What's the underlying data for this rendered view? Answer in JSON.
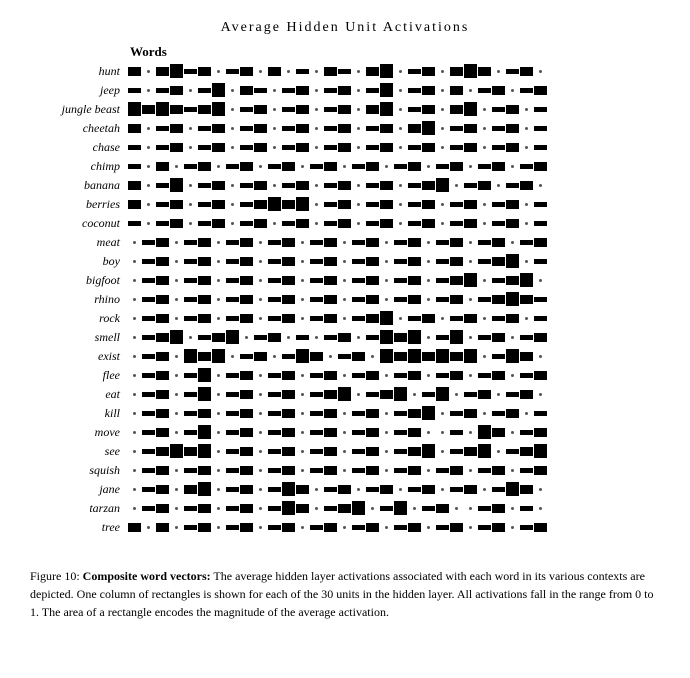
{
  "title": "Average Hidden Unit Activations",
  "words_label": "Words",
  "caption": {
    "figure_label": "Figure 10:",
    "bold_part": "Composite word vectors:",
    "text": " The average hidden layer activations associated with each word in its various contexts are depicted. One column of rectangles is shown for each of the 30 units in the hidden layer. All activations fall in the range from 0 to 1. The area of a rectangle encodes the magnitude of the average activation."
  },
  "words": [
    "hunt",
    "jeep",
    "jungle beast",
    "cheetah",
    "chase",
    "chimp",
    "banana",
    "berries",
    "coconut",
    "meat",
    "boy",
    "bigfoot",
    "rhino",
    "rock",
    "smell",
    "exist",
    "flee",
    "eat",
    "kill",
    "move",
    "see",
    "squish",
    "jane",
    "tarzan",
    "tree"
  ],
  "rows": [
    [
      2,
      0,
      1,
      2,
      3,
      0,
      1,
      2,
      0,
      1,
      2,
      0,
      1,
      3,
      0,
      1,
      2,
      0,
      1,
      2,
      3,
      0,
      1,
      2,
      0,
      1,
      2,
      3,
      0,
      1
    ],
    [
      1,
      0,
      1,
      2,
      0,
      1,
      2,
      3,
      0,
      1,
      2,
      0,
      1,
      2,
      0,
      1,
      2,
      0,
      1,
      2,
      0,
      1,
      2,
      0,
      1,
      2,
      0,
      1,
      2,
      0
    ],
    [
      3,
      2,
      1,
      3,
      2,
      1,
      2,
      0,
      1,
      2,
      3,
      0,
      1,
      2,
      0,
      1,
      2,
      0,
      1,
      3,
      0,
      1,
      2,
      0,
      1,
      2,
      0,
      1,
      2,
      0
    ],
    [
      2,
      0,
      1,
      2,
      0,
      1,
      2,
      0,
      1,
      2,
      0,
      1,
      2,
      0,
      1,
      2,
      0,
      1,
      2,
      0,
      1,
      2,
      3,
      0,
      1,
      2,
      0,
      1,
      2,
      0
    ],
    [
      1,
      0,
      1,
      2,
      0,
      1,
      2,
      0,
      1,
      2,
      0,
      1,
      2,
      0,
      1,
      2,
      0,
      1,
      2,
      0,
      1,
      2,
      0,
      1,
      2,
      0,
      1,
      2,
      0,
      1
    ],
    [
      1,
      0,
      1,
      2,
      0,
      1,
      2,
      0,
      1,
      2,
      0,
      1,
      2,
      0,
      1,
      2,
      0,
      1,
      2,
      0,
      1,
      2,
      0,
      1,
      2,
      0,
      1,
      2,
      0,
      1
    ],
    [
      2,
      0,
      1,
      2,
      0,
      1,
      2,
      0,
      1,
      2,
      0,
      1,
      2,
      0,
      1,
      2,
      0,
      1,
      2,
      0,
      1,
      2,
      0,
      1,
      2,
      3,
      0,
      1,
      2,
      0
    ],
    [
      2,
      0,
      1,
      2,
      0,
      1,
      2,
      0,
      1,
      2,
      3,
      0,
      1,
      2,
      3,
      0,
      1,
      2,
      0,
      1,
      2,
      0,
      1,
      2,
      0,
      1,
      2,
      0,
      1,
      2
    ],
    [
      1,
      0,
      1,
      2,
      0,
      1,
      2,
      0,
      1,
      2,
      0,
      1,
      2,
      0,
      1,
      2,
      0,
      1,
      2,
      0,
      1,
      2,
      0,
      1,
      2,
      0,
      1,
      2,
      0,
      1
    ],
    [
      0,
      1,
      2,
      0,
      1,
      2,
      0,
      1,
      2,
      0,
      1,
      2,
      0,
      1,
      2,
      0,
      1,
      2,
      0,
      1,
      2,
      0,
      1,
      2,
      0,
      1,
      2,
      0,
      1,
      2
    ],
    [
      0,
      1,
      2,
      0,
      1,
      2,
      0,
      1,
      2,
      0,
      1,
      2,
      0,
      1,
      2,
      0,
      1,
      2,
      0,
      1,
      2,
      0,
      1,
      2,
      0,
      1,
      2,
      0,
      1,
      2
    ],
    [
      0,
      1,
      2,
      0,
      1,
      2,
      0,
      1,
      2,
      0,
      1,
      2,
      0,
      1,
      2,
      0,
      1,
      2,
      0,
      1,
      2,
      0,
      1,
      2,
      3,
      0,
      1,
      2,
      0,
      1
    ],
    [
      0,
      1,
      2,
      0,
      1,
      2,
      0,
      1,
      2,
      0,
      1,
      2,
      0,
      1,
      2,
      0,
      1,
      2,
      0,
      1,
      2,
      0,
      1,
      2,
      0,
      1,
      2,
      3,
      0,
      1
    ],
    [
      0,
      1,
      2,
      0,
      1,
      2,
      0,
      1,
      2,
      0,
      1,
      2,
      0,
      1,
      2,
      0,
      1,
      2,
      0,
      1,
      2,
      3,
      0,
      1,
      2,
      0,
      1,
      2,
      0,
      1
    ],
    [
      0,
      1,
      2,
      3,
      0,
      1,
      2,
      0,
      1,
      2,
      0,
      1,
      2,
      0,
      1,
      2,
      0,
      1,
      2,
      3,
      0,
      1,
      2,
      3,
      0,
      1,
      2,
      0,
      1,
      2
    ],
    [
      0,
      1,
      2,
      0,
      1,
      3,
      2,
      0,
      1,
      2,
      0,
      1,
      2,
      3,
      0,
      1,
      2,
      0,
      1,
      2,
      3,
      0,
      1,
      2,
      3,
      0,
      1,
      2,
      3,
      0
    ],
    [
      0,
      1,
      2,
      0,
      1,
      2,
      3,
      0,
      1,
      2,
      0,
      1,
      2,
      0,
      1,
      2,
      0,
      1,
      2,
      0,
      1,
      2,
      0,
      1,
      2,
      0,
      1,
      2,
      0,
      1
    ],
    [
      0,
      1,
      2,
      0,
      1,
      3,
      2,
      0,
      1,
      2,
      0,
      1,
      2,
      0,
      1,
      2,
      3,
      0,
      1,
      2,
      0,
      1,
      2,
      3,
      0,
      1,
      2,
      0,
      1,
      2
    ],
    [
      0,
      1,
      2,
      0,
      1,
      2,
      0,
      1,
      2,
      0,
      1,
      2,
      0,
      1,
      2,
      0,
      1,
      2,
      0,
      1,
      2,
      0,
      1,
      2,
      0,
      1,
      2,
      0,
      1,
      2
    ],
    [
      0,
      1,
      2,
      0,
      1,
      2,
      3,
      0,
      1,
      2,
      0,
      1,
      2,
      0,
      1,
      2,
      0,
      1,
      2,
      0,
      1,
      2,
      0,
      1,
      0,
      1,
      2,
      3,
      0,
      1
    ],
    [
      0,
      1,
      2,
      3,
      0,
      1,
      2,
      0,
      1,
      2,
      0,
      1,
      2,
      0,
      1,
      2,
      0,
      1,
      2,
      0,
      1,
      2,
      3,
      0,
      1,
      2,
      0,
      1,
      2,
      3
    ],
    [
      0,
      1,
      2,
      0,
      1,
      2,
      0,
      1,
      2,
      0,
      1,
      2,
      0,
      1,
      2,
      0,
      1,
      2,
      0,
      1,
      2,
      0,
      1,
      2,
      0,
      1,
      2,
      0,
      1,
      2
    ],
    [
      0,
      1,
      2,
      0,
      1,
      3,
      0,
      1,
      2,
      0,
      1,
      2,
      3,
      0,
      1,
      2,
      0,
      1,
      2,
      0,
      1,
      2,
      0,
      1,
      2,
      0,
      1,
      2,
      3,
      0
    ],
    [
      0,
      1,
      2,
      0,
      1,
      2,
      0,
      1,
      2,
      0,
      1,
      2,
      3,
      0,
      1,
      2,
      0,
      1,
      2,
      3,
      0,
      1,
      2,
      0,
      1,
      2,
      0,
      1,
      0,
      1
    ],
    [
      2,
      0,
      1,
      0,
      1,
      2,
      0,
      1,
      2,
      0,
      1,
      2,
      0,
      1,
      2,
      0,
      1,
      2,
      0,
      1,
      2,
      0,
      1,
      2,
      0,
      1,
      2,
      0,
      1,
      2
    ]
  ]
}
